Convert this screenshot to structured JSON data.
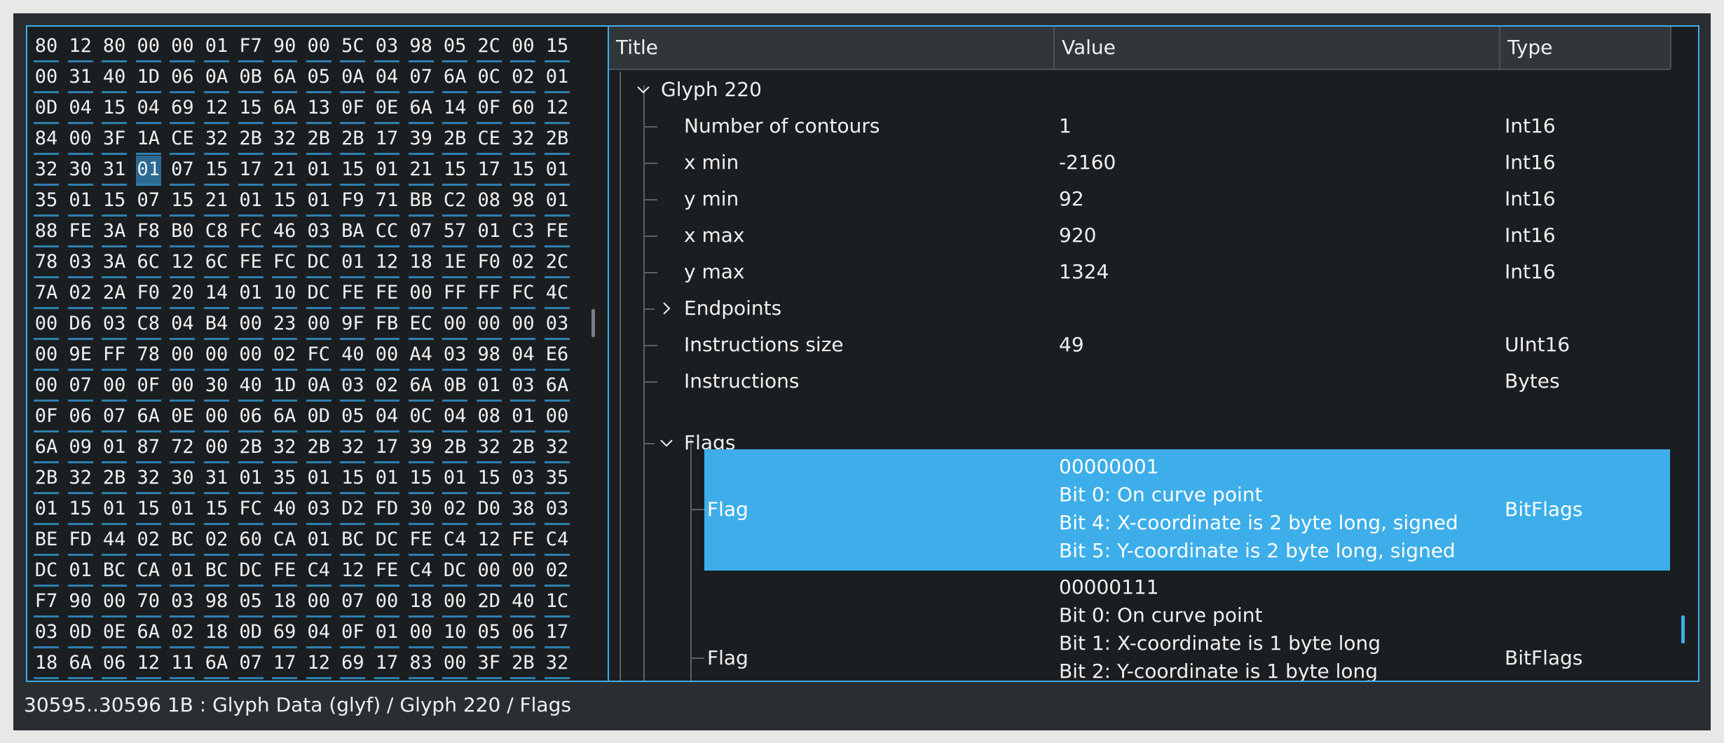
{
  "hex_rows": [
    [
      "80",
      "12",
      "80",
      "00",
      "00",
      "01",
      "F7",
      "90",
      "00",
      "5C",
      "03",
      "98",
      "05",
      "2C",
      "00",
      "15"
    ],
    [
      "00",
      "31",
      "40",
      "1D",
      "06",
      "0A",
      "0B",
      "6A",
      "05",
      "0A",
      "04",
      "07",
      "6A",
      "0C",
      "02",
      "01"
    ],
    [
      "0D",
      "04",
      "15",
      "04",
      "69",
      "12",
      "15",
      "6A",
      "13",
      "0F",
      "0E",
      "6A",
      "14",
      "0F",
      "60",
      "12"
    ],
    [
      "84",
      "00",
      "3F",
      "1A",
      "CE",
      "32",
      "2B",
      "32",
      "2B",
      "2B",
      "17",
      "39",
      "2B",
      "CE",
      "32",
      "2B"
    ],
    [
      "32",
      "30",
      "31",
      "01",
      "07",
      "15",
      "17",
      "21",
      "01",
      "15",
      "01",
      "21",
      "15",
      "17",
      "15",
      "01"
    ],
    [
      "35",
      "01",
      "15",
      "07",
      "15",
      "21",
      "01",
      "15",
      "01",
      "F9",
      "71",
      "BB",
      "C2",
      "08",
      "98",
      "01"
    ],
    [
      "88",
      "FE",
      "3A",
      "F8",
      "B0",
      "C8",
      "FC",
      "46",
      "03",
      "BA",
      "CC",
      "07",
      "57",
      "01",
      "C3",
      "FE"
    ],
    [
      "78",
      "03",
      "3A",
      "6C",
      "12",
      "6C",
      "FE",
      "FC",
      "DC",
      "01",
      "12",
      "18",
      "1E",
      "F0",
      "02",
      "2C"
    ],
    [
      "7A",
      "02",
      "2A",
      "F0",
      "20",
      "14",
      "01",
      "10",
      "DC",
      "FE",
      "FE",
      "00",
      "FF",
      "FF",
      "FC",
      "4C"
    ],
    [
      "00",
      "D6",
      "03",
      "C8",
      "04",
      "B4",
      "00",
      "23",
      "00",
      "9F",
      "FB",
      "EC",
      "00",
      "00",
      "00",
      "03"
    ],
    [
      "00",
      "9E",
      "FF",
      "78",
      "00",
      "00",
      "00",
      "02",
      "FC",
      "40",
      "00",
      "A4",
      "03",
      "98",
      "04",
      "E6"
    ],
    [
      "00",
      "07",
      "00",
      "0F",
      "00",
      "30",
      "40",
      "1D",
      "0A",
      "03",
      "02",
      "6A",
      "0B",
      "01",
      "03",
      "6A"
    ],
    [
      "0F",
      "06",
      "07",
      "6A",
      "0E",
      "00",
      "06",
      "6A",
      "0D",
      "05",
      "04",
      "0C",
      "04",
      "08",
      "01",
      "00"
    ],
    [
      "6A",
      "09",
      "01",
      "87",
      "72",
      "00",
      "2B",
      "32",
      "2B",
      "32",
      "17",
      "39",
      "2B",
      "32",
      "2B",
      "32"
    ],
    [
      "2B",
      "32",
      "2B",
      "32",
      "30",
      "31",
      "01",
      "35",
      "01",
      "15",
      "01",
      "15",
      "01",
      "15",
      "03",
      "35"
    ],
    [
      "01",
      "15",
      "01",
      "15",
      "01",
      "15",
      "FC",
      "40",
      "03",
      "D2",
      "FD",
      "30",
      "02",
      "D0",
      "38",
      "03"
    ],
    [
      "BE",
      "FD",
      "44",
      "02",
      "BC",
      "02",
      "60",
      "CA",
      "01",
      "BC",
      "DC",
      "FE",
      "C4",
      "12",
      "FE",
      "C4"
    ],
    [
      "DC",
      "01",
      "BC",
      "CA",
      "01",
      "BC",
      "DC",
      "FE",
      "C4",
      "12",
      "FE",
      "C4",
      "DC",
      "00",
      "00",
      "02"
    ],
    [
      "F7",
      "90",
      "00",
      "70",
      "03",
      "98",
      "05",
      "18",
      "00",
      "07",
      "00",
      "18",
      "00",
      "2D",
      "40",
      "1C"
    ],
    [
      "03",
      "0D",
      "0E",
      "6A",
      "02",
      "18",
      "0D",
      "69",
      "04",
      "0F",
      "01",
      "00",
      "10",
      "05",
      "06",
      "17"
    ],
    [
      "18",
      "6A",
      "06",
      "12",
      "11",
      "6A",
      "07",
      "17",
      "12",
      "69",
      "17",
      "83",
      "00",
      "3F",
      "2B",
      "32"
    ]
  ],
  "hex_selected": {
    "row": 4,
    "col": 3
  },
  "tree": {
    "columns": {
      "title": "Title",
      "value": "Value",
      "type": "Type"
    },
    "glyph": "Glyph 220",
    "rows": [
      {
        "title": "Number of contours",
        "value": "1",
        "type": "Int16"
      },
      {
        "title": "x min",
        "value": "-2160",
        "type": "Int16"
      },
      {
        "title": "y min",
        "value": "92",
        "type": "Int16"
      },
      {
        "title": "x max",
        "value": "920",
        "type": "Int16"
      },
      {
        "title": "y max",
        "value": "1324",
        "type": "Int16"
      },
      {
        "title": "Endpoints",
        "value": "",
        "type": ""
      },
      {
        "title": "Instructions size",
        "value": "49",
        "type": "UInt16"
      },
      {
        "title": "Instructions",
        "value": "",
        "type": "Bytes"
      }
    ],
    "flags_label": "Flags",
    "flag1": {
      "title": "Flag",
      "type": "BitFlags",
      "lines": [
        "00000001",
        "Bit 0: On curve point",
        "Bit 4: X-coordinate is 2 byte long, signed",
        "Bit 5: Y-coordinate is 2 byte long, signed"
      ]
    },
    "flag2": {
      "title": "Flag",
      "type": "BitFlags",
      "lines": [
        "00000111",
        "Bit 0: On curve point",
        "Bit 1: X-coordinate is 1 byte long",
        "Bit 2: Y-coordinate is 1 byte long"
      ]
    }
  },
  "status": "30595..30596 1B : Glyph Data (glyf) / Glyph 220 / Flags",
  "colors": {
    "accent": "#3daee9",
    "background": "#2a2e32",
    "view": "#1b1e20"
  }
}
